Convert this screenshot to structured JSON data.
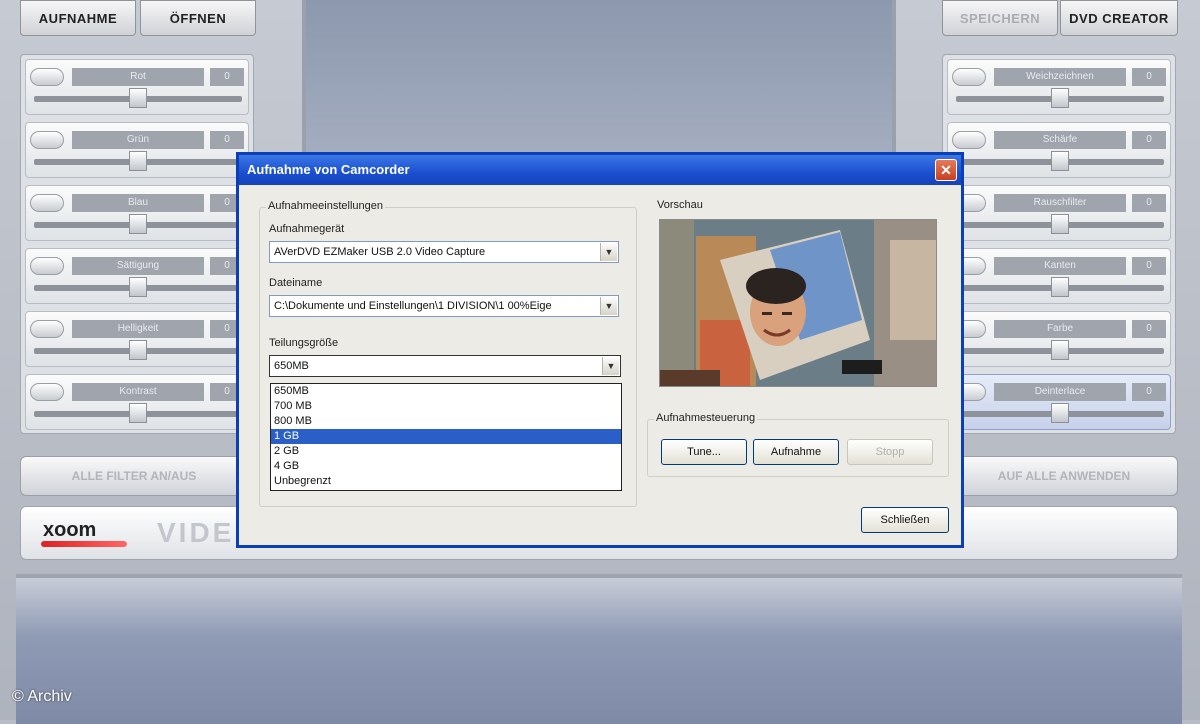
{
  "toolbar": {
    "left": [
      "AUFNAHME",
      "ÖFFNEN"
    ],
    "right": [
      "SPEICHERN",
      "DVD CREATOR"
    ]
  },
  "left_filters": [
    {
      "label": "Rot",
      "value": "0",
      "level": 0.5
    },
    {
      "label": "Grün",
      "value": "0",
      "level": 0.5
    },
    {
      "label": "Blau",
      "value": "0",
      "level": 0.5
    },
    {
      "label": "Sättigung",
      "value": "0",
      "level": 0.5
    },
    {
      "label": "Helligkeit",
      "value": "0",
      "level": 0.5
    },
    {
      "label": "Kontrast",
      "value": "0",
      "level": 0.5
    }
  ],
  "right_filters": [
    {
      "label": "Weichzeichnen",
      "value": "0",
      "level": 0.5,
      "active": false
    },
    {
      "label": "Schärfe",
      "value": "0",
      "level": 0.5,
      "active": false
    },
    {
      "label": "Rauschfilter",
      "value": "0",
      "level": 0.5,
      "active": false
    },
    {
      "label": "Kanten",
      "value": "0",
      "level": 0.5,
      "active": false
    },
    {
      "label": "Farbe",
      "value": "0",
      "level": 0.5,
      "active": false
    },
    {
      "label": "Deinterlace",
      "value": "0",
      "level": 0.5,
      "active": true
    }
  ],
  "bottom_buttons": {
    "left": "ALLE FILTER AN/AUS",
    "right": "AUF ALLE ANWENDEN"
  },
  "brand": {
    "logo": "xoom",
    "product_partial": "VIDE"
  },
  "dialog": {
    "title": "Aufnahme von Camcorder",
    "settings_legend": "Aufnahmeeinstellungen",
    "device_label": "Aufnahmegerät",
    "device_value": "AVerDVD EZMaker USB 2.0 Video Capture",
    "filename_label": "Dateiname",
    "filename_value": "C:\\Dokumente und Einstellungen\\1 DIVISION\\1 00%Eige",
    "partsize_label": "Teilungsgröße",
    "partsize_value": "650MB",
    "partsize_options": [
      "650MB",
      "700 MB",
      "800 MB",
      "1 GB",
      "2 GB",
      "4 GB",
      "Unbegrenzt"
    ],
    "partsize_selected_index": 3,
    "preview_label": "Vorschau",
    "control_legend": "Aufnahmesteuerung",
    "tune_button": "Tune...",
    "record_button": "Aufnahme",
    "stop_button": "Stopp",
    "close_button": "Schließen"
  },
  "credit": "© Archiv",
  "colors": {
    "titlebar": "#1b4fd0",
    "selection": "#2a5fc8",
    "close_x": "#c8401e"
  }
}
